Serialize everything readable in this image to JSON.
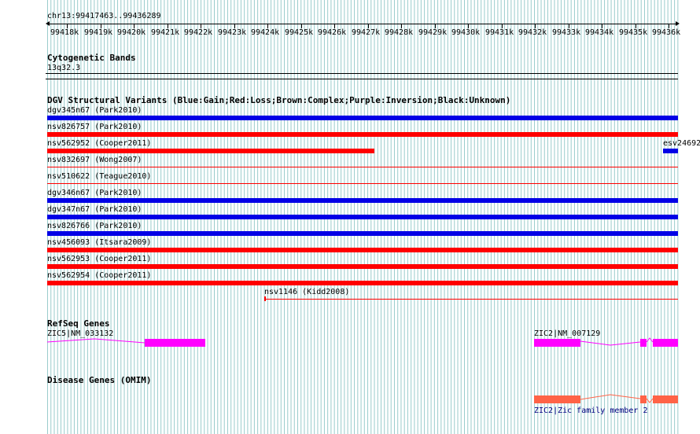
{
  "ruler": {
    "position_label": "chr13:99417463..99436289",
    "ticks": [
      "99418k",
      "99419k",
      "99420k",
      "99421k",
      "99422k",
      "99423k",
      "99424k",
      "99425k",
      "99426k",
      "99427k",
      "99428k",
      "99429k",
      "99430k",
      "99431k",
      "99432k",
      "99433k",
      "99434k",
      "99435k",
      "99436k"
    ]
  },
  "cytoband": {
    "title": "Cytogenetic Bands",
    "band": "13q32.3"
  },
  "dgv": {
    "title": "DGV Structural Variants (Blue:Gain;Red:Loss;Brown:Complex;Purple:Inversion;Black:Unknown)",
    "variants": [
      {
        "label": "dgv345n67 (Park2010)",
        "color": "#0000e6"
      },
      {
        "label": "nsv826757 (Park2010)",
        "color": "#ff0000"
      },
      {
        "label": "nsv562952 (Cooper2011)",
        "color": "#ff0000"
      },
      {
        "label": "nsv832697 (Wong2007)",
        "color": "#ff0000"
      },
      {
        "label": "nsv510622 (Teague2010)",
        "color": "#ff0000"
      },
      {
        "label": "dgv346n67 (Park2010)",
        "color": "#0000e6"
      },
      {
        "label": "dgv347n67 (Park2010)",
        "color": "#0000e6"
      },
      {
        "label": "nsv826766 (Park2010)",
        "color": "#0000e6"
      },
      {
        "label": "nsv456093 (Itsara2009)",
        "color": "#ff0000"
      },
      {
        "label": "nsv562953 (Cooper2011)",
        "color": "#ff0000"
      },
      {
        "label": "nsv562954 (Cooper2011)",
        "color": "#ff0000"
      },
      {
        "label": "nsv1146 (Kidd2008)",
        "color": "#ff0000"
      },
      {
        "label": "esv24692",
        "color": "#0000e6"
      }
    ]
  },
  "refseq": {
    "title": "RefSeq Genes",
    "genes": [
      {
        "label": "ZIC5|NM_033132",
        "color": "#ff00ff"
      },
      {
        "label": "ZIC2|NM_007129",
        "color": "#ff00ff"
      }
    ]
  },
  "omim": {
    "title": "Disease Genes (OMIM)",
    "genes": [
      {
        "label": "ZIC2|Zic family member 2",
        "color": "#ff6347"
      }
    ]
  },
  "colors": {
    "grid_line": "#99cccc",
    "gain": "#0000e6",
    "loss": "#ff0000",
    "refseq": "#ff00ff",
    "omim": "#ff6347",
    "label_link": "#000080"
  }
}
